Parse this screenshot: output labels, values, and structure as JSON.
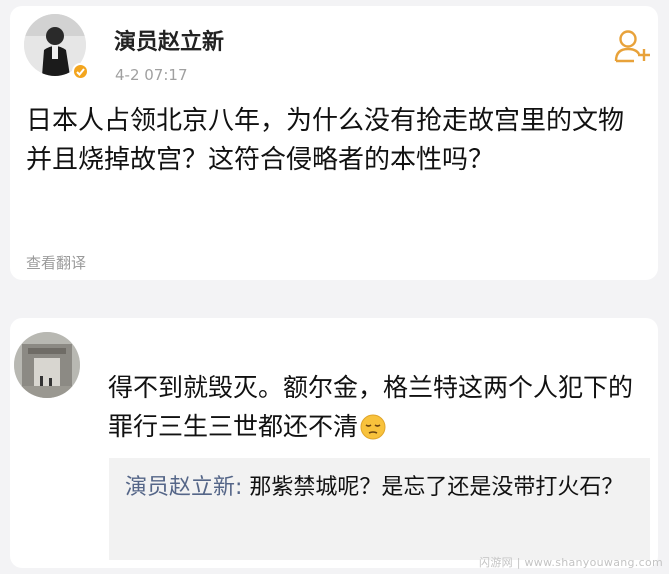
{
  "post": {
    "author": "演员赵立新",
    "time": "4-2 07:17",
    "text": "日本人占领北京八年，为什么没有抢走故宫里的文物并且烧掉故宫？这符合侵略者的本性吗？",
    "translate_label": "查看翻译",
    "follow_icon": "add-user-icon",
    "verified_color": "#f3a51e"
  },
  "comment": {
    "text": "得不到就毁灭。额尔金，格兰特这两个人犯下的罪行三生三世都还不清",
    "emoji": "pensive-face-emoji",
    "reply": {
      "author": "演员赵立新:",
      "text": " 那紫禁城呢？是忘了还是没带打火石？"
    }
  },
  "watermark": "闪游网 | www.shanyouwang.com"
}
